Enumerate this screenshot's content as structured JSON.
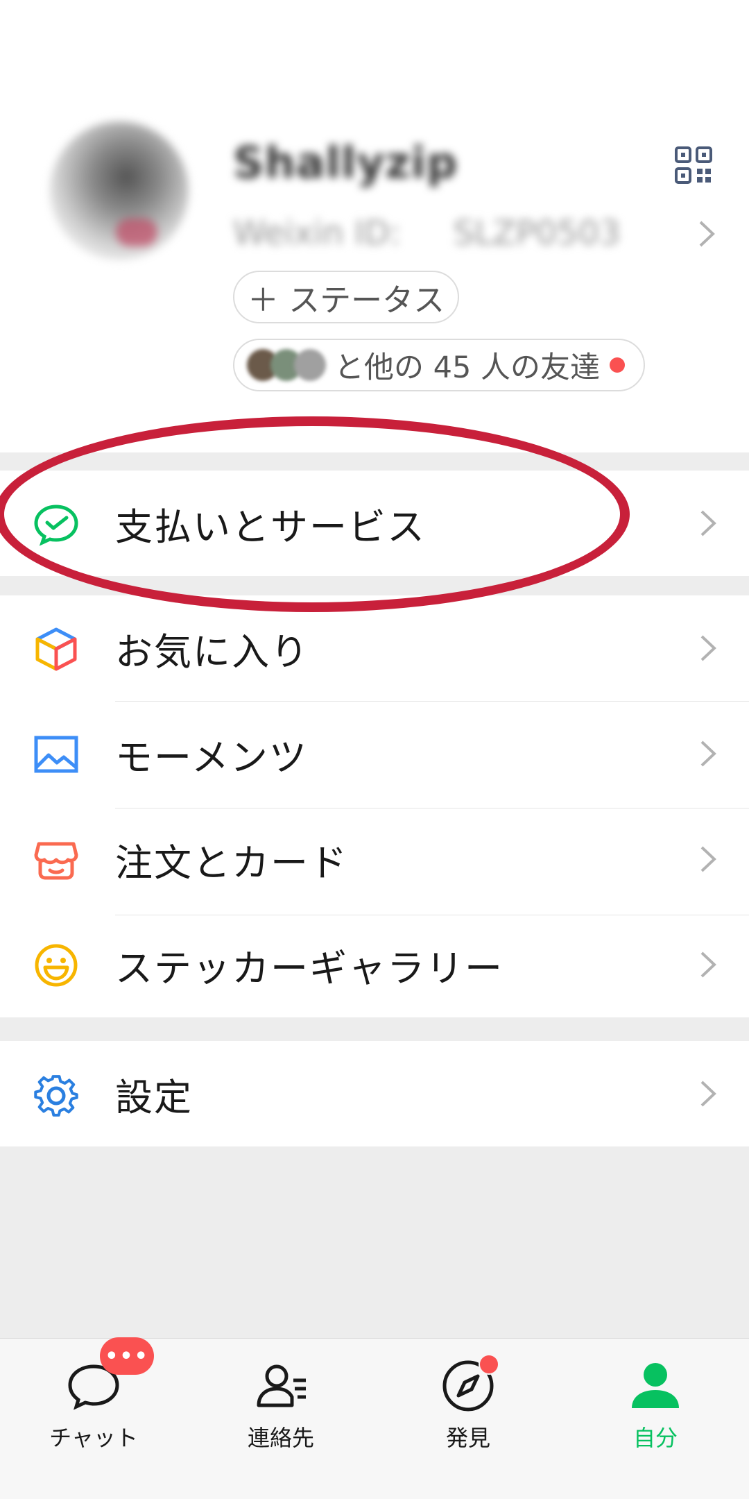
{
  "profile": {
    "name": "Shallyzip",
    "wechat_id_label": "Weixin ID:",
    "wechat_id": "SLZP0503",
    "status_button": "＋ ステータス",
    "friends_text": "と他の 45 人の友達",
    "friend_avatar_colors": [
      "#6b5a4a",
      "#7a8f7a",
      "#a0a0a0"
    ]
  },
  "menu": {
    "pay": {
      "label": "支払いとサービス",
      "icon": "wechat-pay-icon"
    },
    "favorites": {
      "label": "お気に入り",
      "icon": "favorites-cube-icon"
    },
    "moments": {
      "label": "モーメンツ",
      "icon": "image-icon"
    },
    "orders": {
      "label": "注文とカード",
      "icon": "shop-icon"
    },
    "stickers": {
      "label": "ステッカーギャラリー",
      "icon": "smiley-icon"
    },
    "settings": {
      "label": "設定",
      "icon": "gear-icon"
    }
  },
  "tabbar": {
    "chats": {
      "label": "チャット",
      "badge": "•••"
    },
    "contacts": {
      "label": "連絡先"
    },
    "discover": {
      "label": "発見"
    },
    "me": {
      "label": "自分"
    }
  },
  "colors": {
    "brand_green": "#07c160",
    "badge_red": "#fa5151",
    "annotation_red": "#c8203a",
    "background": "#ededed"
  }
}
